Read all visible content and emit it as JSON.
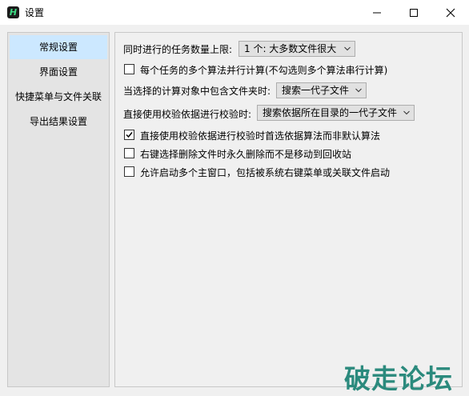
{
  "window": {
    "title": "设置",
    "app_icon_glyph": "H",
    "controls": [
      "minimize-icon",
      "maximize-icon",
      "close-icon"
    ]
  },
  "sidebar": {
    "items": [
      {
        "label": "常规设置",
        "selected": true
      },
      {
        "label": "界面设置",
        "selected": false
      },
      {
        "label": "快捷菜单与文件关联",
        "selected": false
      },
      {
        "label": "导出结果设置",
        "selected": false
      }
    ]
  },
  "settings": {
    "max_tasks": {
      "label": "同时进行的任务数量上限:",
      "value": "1 个: 大多数文件很大"
    },
    "parallel_algorithms": {
      "label": "每个任务的多个算法并行计算(不勾选则多个算法串行计算)",
      "checked": false
    },
    "folder_target": {
      "label": "当选择的计算对象中包含文件夹时:",
      "value": "搜索一代子文件"
    },
    "verify_source": {
      "label": "直接使用校验依据进行校验时:",
      "value": "搜索依据所在目录的一代子文件"
    },
    "prefer_algorithm": {
      "label": "直接使用校验依据进行校验时首选依据算法而非默认算法",
      "checked": true
    },
    "permanent_delete": {
      "label": "右键选择删除文件时永久删除而不是移动到回收站",
      "checked": false
    },
    "multi_window": {
      "label": "允许启动多个主窗口，包括被系统右键菜单或关联文件启动",
      "checked": false
    }
  },
  "watermark": "破走论坛",
  "colors": {
    "selected_nav": "#cce8ff",
    "watermark": "#2b8a7d"
  }
}
